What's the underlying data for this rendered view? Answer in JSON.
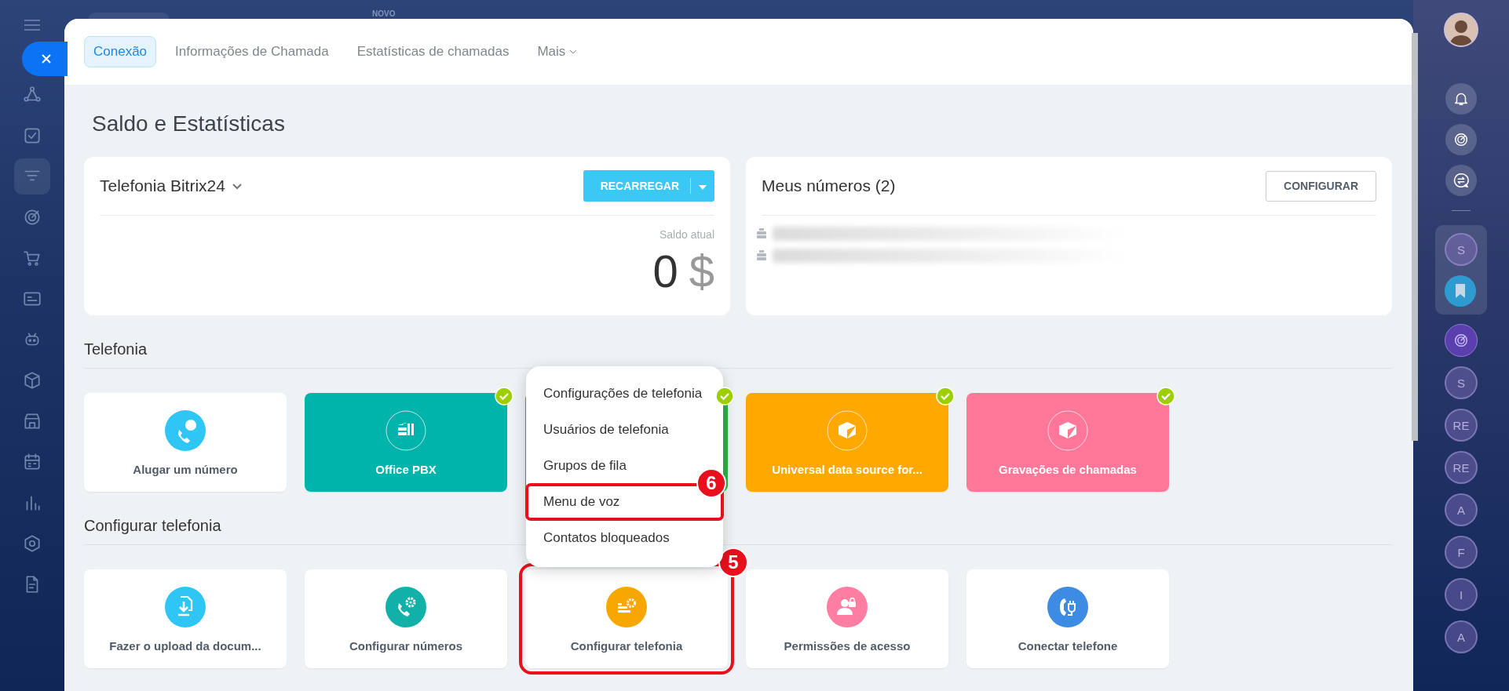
{
  "top_bar": {
    "badge": "NOVO"
  },
  "left_sidebar": {
    "items": [
      {
        "selected": false
      },
      {
        "selected": false
      },
      {
        "selected": true
      },
      {
        "selected": false
      },
      {
        "selected": false
      },
      {
        "selected": false
      },
      {
        "selected": false
      },
      {
        "selected": false
      },
      {
        "selected": false
      },
      {
        "selected": false
      },
      {
        "selected": false
      },
      {
        "selected": false
      },
      {
        "selected": false
      }
    ]
  },
  "tabs": [
    {
      "label": "Conexão",
      "selected": true,
      "dropdown": false
    },
    {
      "label": "Informações de Chamada",
      "selected": false,
      "dropdown": false
    },
    {
      "label": "Estatísticas de chamadas",
      "selected": false,
      "dropdown": false
    },
    {
      "label": "Mais",
      "selected": false,
      "dropdown": true
    }
  ],
  "page_title": "Saldo e Estatísticas",
  "balance_card": {
    "title": "Telefonia Bitrix24",
    "button": "RECARREGAR",
    "balance_label": "Saldo atual",
    "balance": "0",
    "currency": "$"
  },
  "numbers_card": {
    "title": "Meus números (2)",
    "button": "CONFIGURAR"
  },
  "sections": [
    {
      "title": "Telefonia",
      "tiles": [
        {
          "label": "Alugar um número",
          "kind": "plain",
          "color": "#2fc6f6",
          "connected": false
        },
        {
          "label": "Office PBX",
          "kind": "filled",
          "color": "#00b4ac",
          "connected": true
        },
        {
          "kind": "filled",
          "color": "#2fb344",
          "connected": true
        },
        {
          "label": "Universal data source for...",
          "kind": "filled",
          "color": "#ffa900",
          "connected": true
        },
        {
          "label": "Gravações de chamadas",
          "kind": "filled",
          "color": "#ff7799",
          "connected": true
        }
      ]
    },
    {
      "title": "Configurar telefonia",
      "tiles": [
        {
          "label": "Fazer o upload da docum...",
          "kind": "plain",
          "color": "#2fc6f6",
          "connected": false
        },
        {
          "label": "Configurar números",
          "kind": "plain",
          "color": "#12b1a8",
          "connected": false
        },
        {
          "label": "Configurar telefonia",
          "kind": "plain",
          "color": "#f7a700",
          "connected": false,
          "step": "5"
        },
        {
          "label": "Permissões de acesso",
          "kind": "plain",
          "color": "#ff7ea2",
          "connected": false
        },
        {
          "label": "Conectar telefone",
          "kind": "plain",
          "color": "#3e8be4",
          "connected": false
        }
      ]
    }
  ],
  "menu": {
    "items": [
      {
        "label": "Configurações de telefonia"
      },
      {
        "label": "Usuários de telefonia"
      },
      {
        "label": "Grupos de fila"
      },
      {
        "label": "Menu de voz",
        "step": "6"
      },
      {
        "label": "Contatos bloqueados"
      }
    ]
  },
  "right_sidebar": {
    "pinned": [
      {
        "initials": "S"
      }
    ],
    "chats": [
      {
        "initials": "S"
      },
      {
        "initials": "RE"
      },
      {
        "initials": "RE"
      },
      {
        "initials": "A"
      },
      {
        "initials": "F"
      },
      {
        "initials": "I"
      },
      {
        "initials": "A"
      }
    ]
  }
}
